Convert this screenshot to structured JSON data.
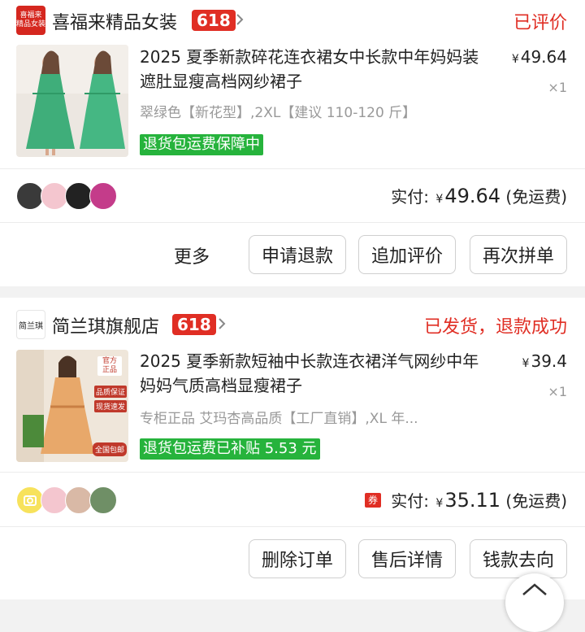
{
  "orders": [
    {
      "shop": {
        "logo_text": "喜福来\n精品女装",
        "name": "喜福来精品女装",
        "badge": "618"
      },
      "status": "已评价",
      "item": {
        "title": "2025 夏季新款碎花连衣裙女中长款中年妈妈装遮肚显瘦高档网纱裙子",
        "price_symbol": "¥",
        "price": "49.64",
        "qty": "×1",
        "spec": "翠绿色【新花型】,2XL【建议 110-120 斤】",
        "tag": "退货包运费保障中"
      },
      "payment": {
        "label": "实付:",
        "symbol": "¥",
        "amount": "49.64",
        "shipping": "(免运费)"
      },
      "actions": {
        "more": "更多",
        "buttons": [
          "申请退款",
          "追加评价",
          "再次拼单"
        ]
      }
    },
    {
      "shop": {
        "logo_text": "简兰琪",
        "name": "简兰琪旗舰店",
        "badge": "618"
      },
      "status": "已发货，退款成功",
      "item": {
        "title": "2025 夏季新款短袖中长款连衣裙洋气网纱中年妈妈气质高档显瘦裙子",
        "price_symbol": "¥",
        "price": "39.4",
        "qty": "×1",
        "spec": "专柜正品 艾玛杏高品质【工厂直销】,XL 年...",
        "tag": "退货包运费已补贴 5.53 元",
        "thumb_labels": [
          "官方正品",
          "品质保证",
          "现货速发",
          "全国包邮"
        ]
      },
      "payment": {
        "coupon": "券",
        "label": "实付:",
        "symbol": "¥",
        "amount": "35.11",
        "shipping": "(免运费)"
      },
      "actions": {
        "buttons": [
          "删除订单",
          "售后详情",
          "钱款去向"
        ]
      }
    }
  ],
  "icons": [
    "chevron-right-icon",
    "scroll-top-icon",
    "camera-icon"
  ],
  "colors": {
    "brand_red": "#e02e24",
    "tag_green": "#26b33c",
    "background": "#f2f2f2"
  }
}
